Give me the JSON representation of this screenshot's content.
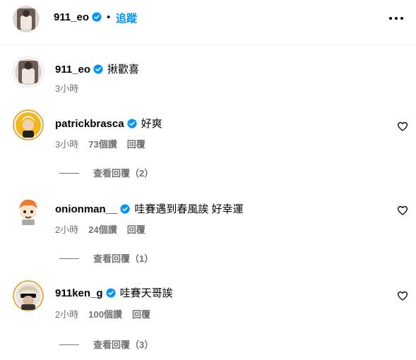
{
  "header": {
    "username": "911_eo",
    "dot": "•",
    "follow_label": "追蹤"
  },
  "caption": {
    "username": "911_eo",
    "text": "揪歡喜",
    "time": "3小時"
  },
  "comments": [
    {
      "username": "patrickbrasca",
      "text": "好爽",
      "time": "3小時",
      "likes": "73個讚",
      "reply_label": "回覆",
      "view_replies": "查看回覆（2）"
    },
    {
      "username": "onionman__",
      "text": "哇賽遇到春風誒 好幸運",
      "time": "2小時",
      "likes": "24個讚",
      "reply_label": "回覆",
      "view_replies": "查看回覆（1）"
    },
    {
      "username": "911ken_g",
      "text": "哇賽天哥誒",
      "time": "2小時",
      "likes": "100個讚",
      "reply_label": "回覆",
      "view_replies": "查看回覆（3）"
    }
  ],
  "colors": {
    "accent": "#0095f6",
    "secondary_text": "#737373",
    "verified": "#0095f6"
  },
  "icons": {
    "verified": "verified-badge-icon",
    "more": "more-options-icon",
    "like": "heart-icon"
  }
}
